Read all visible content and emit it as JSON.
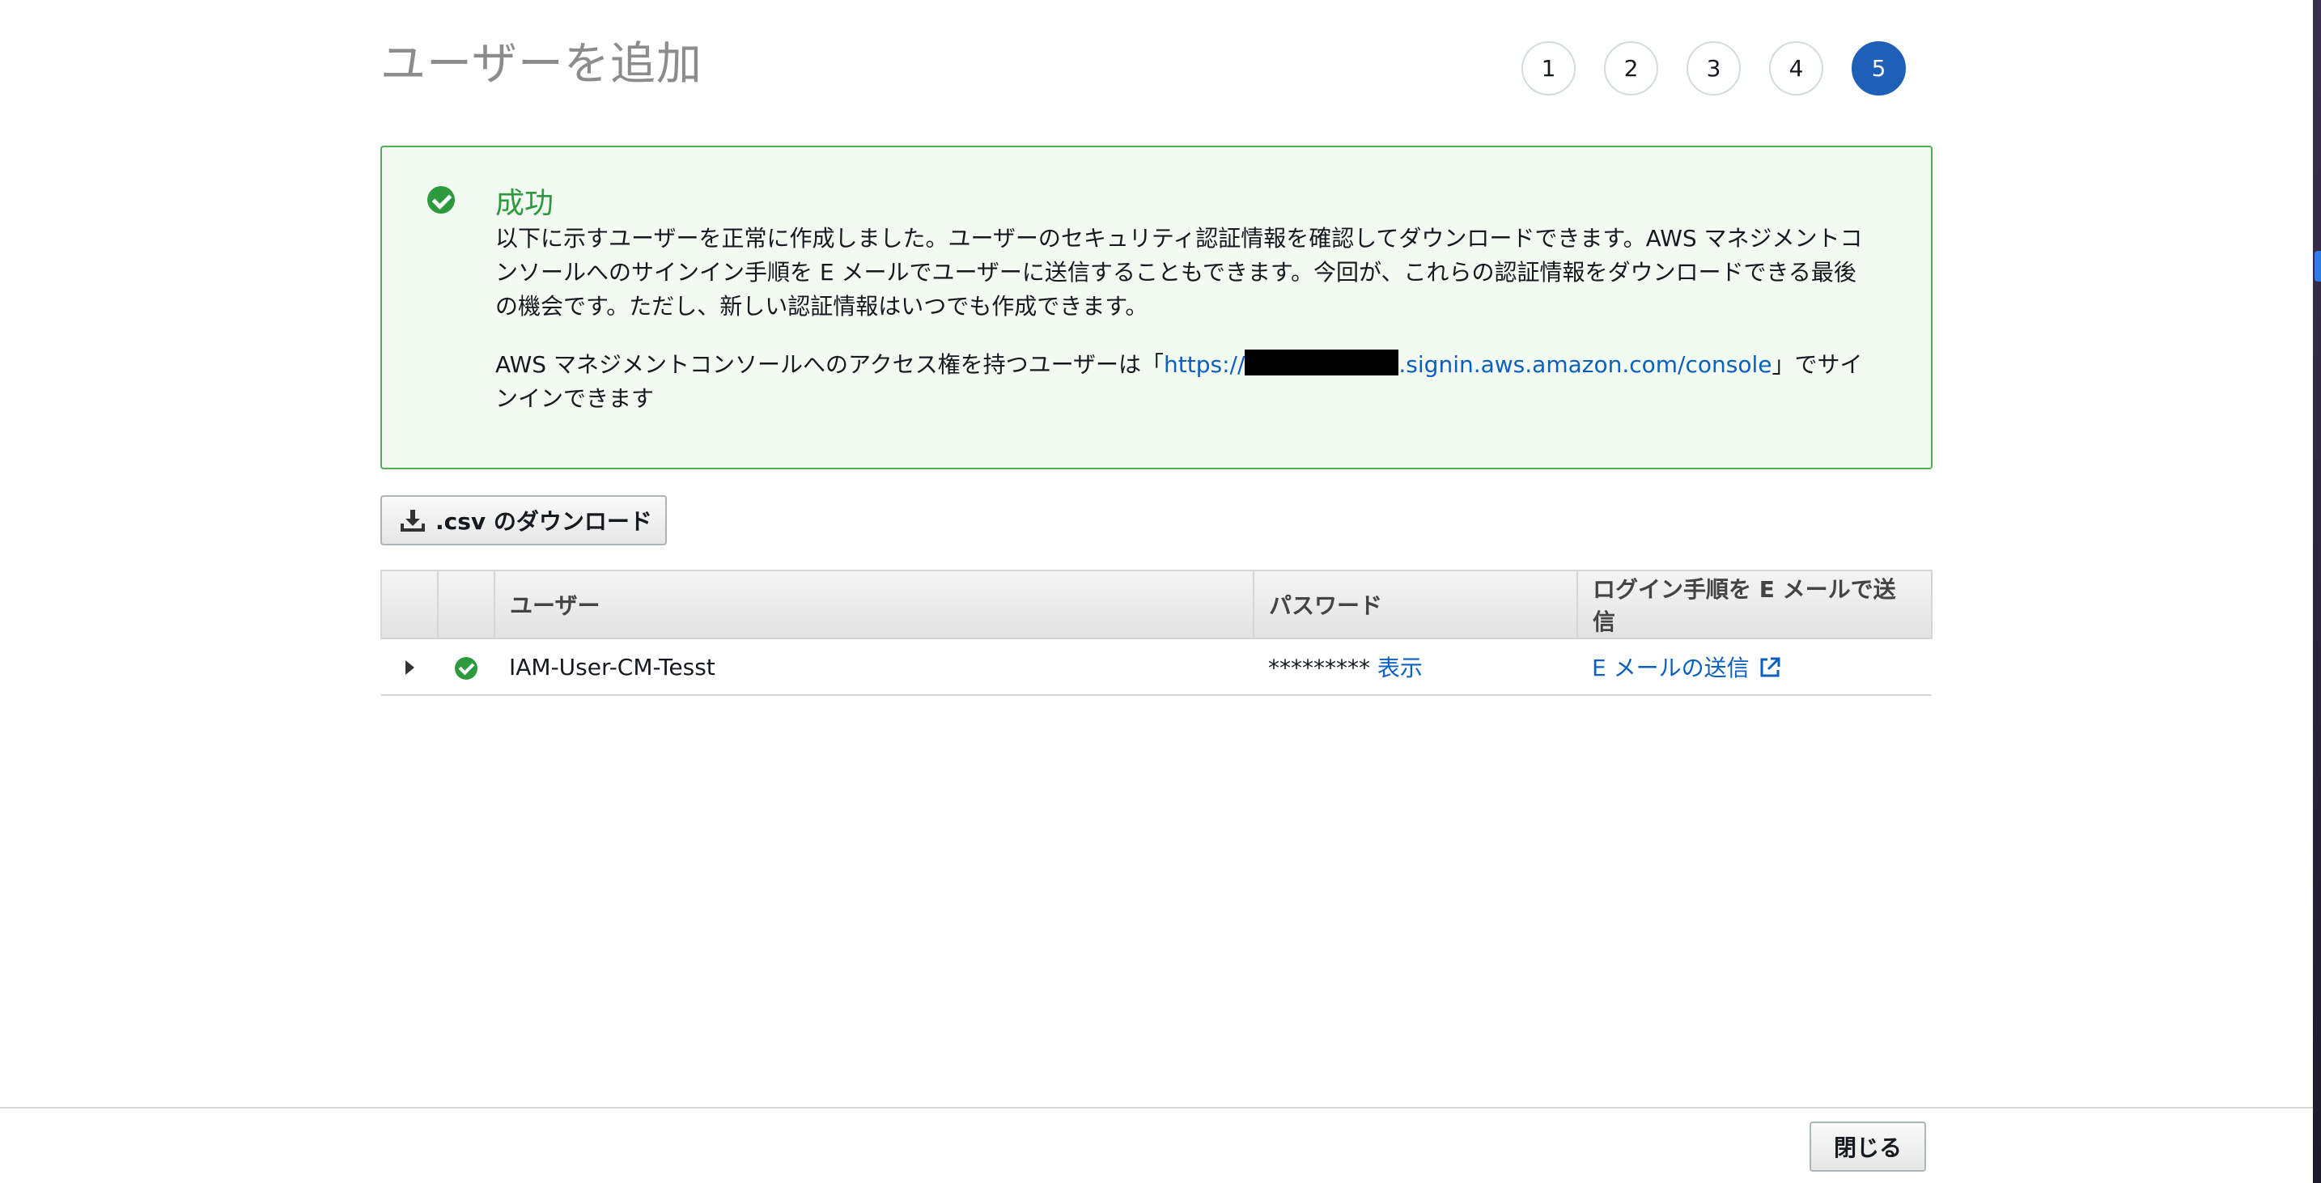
{
  "header": {
    "title": "ユーザーを追加",
    "steps": [
      "1",
      "2",
      "3",
      "4",
      "5"
    ],
    "active_step": "5"
  },
  "success": {
    "title": "成功",
    "message": "以下に示すユーザーを正常に作成しました。ユーザーのセキュリティ認証情報を確認してダウンロードできます。AWS マネジメントコンソールへのサインイン手順を E メールでユーザーに送信することもできます。今回が、これらの認証情報をダウンロードできる最後の機会です。ただし、新しい認証情報はいつでも作成できます。",
    "signin_prefix": "AWS マネジメントコンソールへのアクセス権を持つユーザーは「",
    "signin_link_start": "https://",
    "signin_link_end": ".signin.aws.amazon.com/console",
    "signin_suffix": "」でサインインできます"
  },
  "actions": {
    "download_csv_label": ".csv のダウンロード"
  },
  "table": {
    "headers": {
      "user": "ユーザー",
      "password": "パスワード",
      "email": "ログイン手順を E メールで送信"
    },
    "rows": [
      {
        "user": "IAM-User-CM-Tesst",
        "password_masked": "*********",
        "show_label": "表示",
        "email_label": "E メールの送信"
      }
    ]
  },
  "footer": {
    "close_label": "閉じる"
  },
  "colors": {
    "accent": "#1f5fb8",
    "success": "#2e9a3e",
    "link": "#0b5fbf"
  }
}
